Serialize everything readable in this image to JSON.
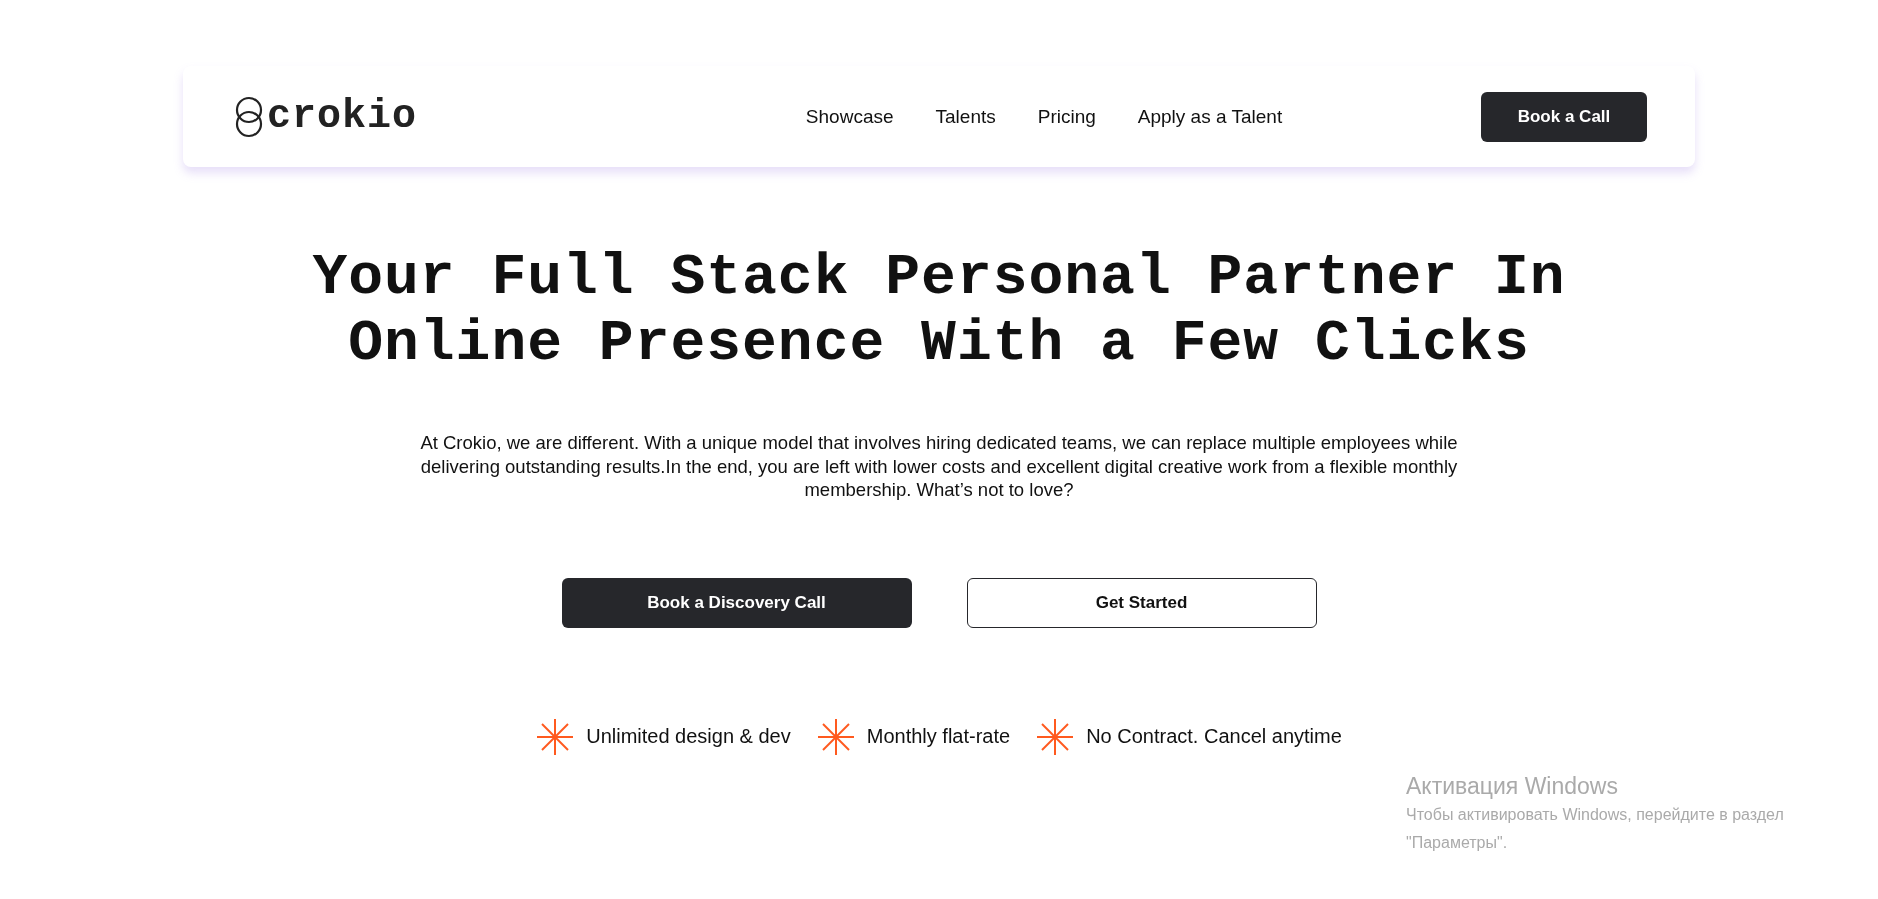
{
  "header": {
    "logo": "crokio",
    "nav": [
      "Showcase",
      "Talents",
      "Pricing",
      "Apply as a Talent"
    ],
    "cta": "Book a Call"
  },
  "hero": {
    "heading_lines": [
      "Your Full Stack Personal Partner In",
      "Online Presence With a Few Clicks"
    ],
    "description": "At Crokio, we are different. With a unique model that involves hiring dedicated teams, we can replace multiple employees while delivering outstanding results.In the end, you are left with lower costs and excellent digital creative work from a flexible monthly membership. What’s not to love?",
    "buttons": [
      {
        "label": "Book a Discovery Call",
        "kind": "primary"
      },
      {
        "label": "Get Started",
        "kind": "secondary"
      }
    ],
    "features": [
      "Unlimited design & dev",
      "Monthly flat-rate",
      "No Contract. Cancel anytime"
    ]
  },
  "os_notice": {
    "title": "Активация Windows",
    "text": "Чтобы активировать Windows, перейдите в раздел \"Параметры\"."
  }
}
